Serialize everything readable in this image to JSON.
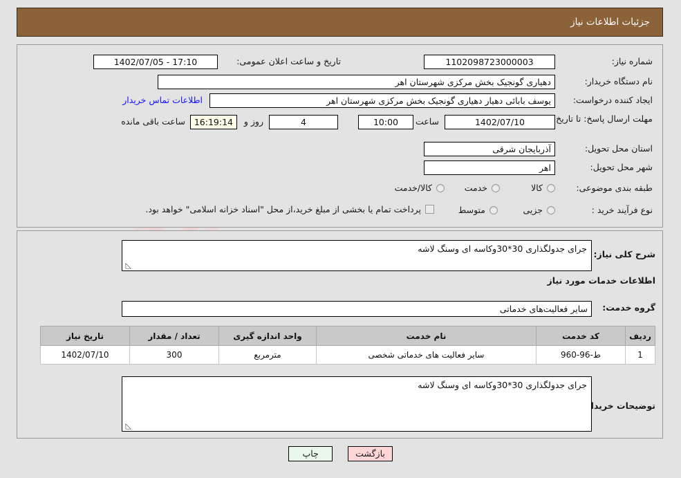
{
  "header": {
    "title": "جزئیات اطلاعات نیاز"
  },
  "watermark": {
    "text": "AriaTender.net"
  },
  "form": {
    "need_number": {
      "label": "شماره نیاز:",
      "value": "1102098723000003"
    },
    "public_announce": {
      "label": "تاریخ و ساعت اعلان عمومی:",
      "value": "17:10 - 1402/07/05"
    },
    "buyer_org": {
      "label": "نام دستگاه خریدار:",
      "value": "دهیاری گونجیک بخش مرکزی شهرستان اهر"
    },
    "request_creator": {
      "label": "ایجاد کننده درخواست:",
      "value": "یوسف بابائی دهیار دهیاری گونجیک بخش مرکزی شهرستان اهر"
    },
    "contact_link": "اطلاعات تماس خریدار",
    "deadline": {
      "label": "مهلت ارسال پاسخ: تا تاریخ:",
      "date": "1402/07/10",
      "time_label": "ساعت",
      "time": "10:00",
      "days": "4",
      "days_suffix": "روز و",
      "countdown": "16:19:14",
      "countdown_suffix": "ساعت باقی مانده"
    },
    "province": {
      "label": "استان محل تحویل:",
      "value": "آذربایجان شرقی"
    },
    "city": {
      "label": "شهر محل تحویل:",
      "value": "اهر"
    },
    "category": {
      "label": "طبقه بندی موضوعی:",
      "options": [
        "کالا",
        "خدمت",
        "کالا/خدمت"
      ]
    },
    "purchase_process": {
      "label": "نوع فرآیند خرید :",
      "options": [
        "جزیی",
        "متوسط"
      ],
      "checkbox_text": "پرداخت تمام یا بخشی از مبلغ خرید،از محل \"اسناد خزانه اسلامی\" خواهد بود."
    }
  },
  "details": {
    "need_description": {
      "label": "شرح کلی نیاز:",
      "value": "جرای جدولگذاری 30*30وکاسه ای وسنگ لاشه"
    },
    "services_heading": "اطلاعات خدمات مورد نیاز",
    "service_group": {
      "label": "گروه خدمت:",
      "value": "سایر فعالیت‌های خدماتی"
    },
    "table": {
      "columns": [
        "ردیف",
        "کد خدمت",
        "نام خدمت",
        "واحد اندازه گیری",
        "تعداد / مقدار",
        "تاریخ نیاز"
      ],
      "rows": [
        {
          "index": "1",
          "service_code": "ط-96-960",
          "service_name": "سایر فعالیت های خدماتی شخصی",
          "unit": "مترمربع",
          "quantity": "300",
          "need_date": "1402/07/10"
        }
      ]
    },
    "buyer_notes": {
      "label": "توضیحات خریدار:",
      "value": "جرای جدولگذاری 30*30وکاسه ای وسنگ لاشه"
    }
  },
  "buttons": {
    "print": "چاپ",
    "back": "بازگشت"
  }
}
